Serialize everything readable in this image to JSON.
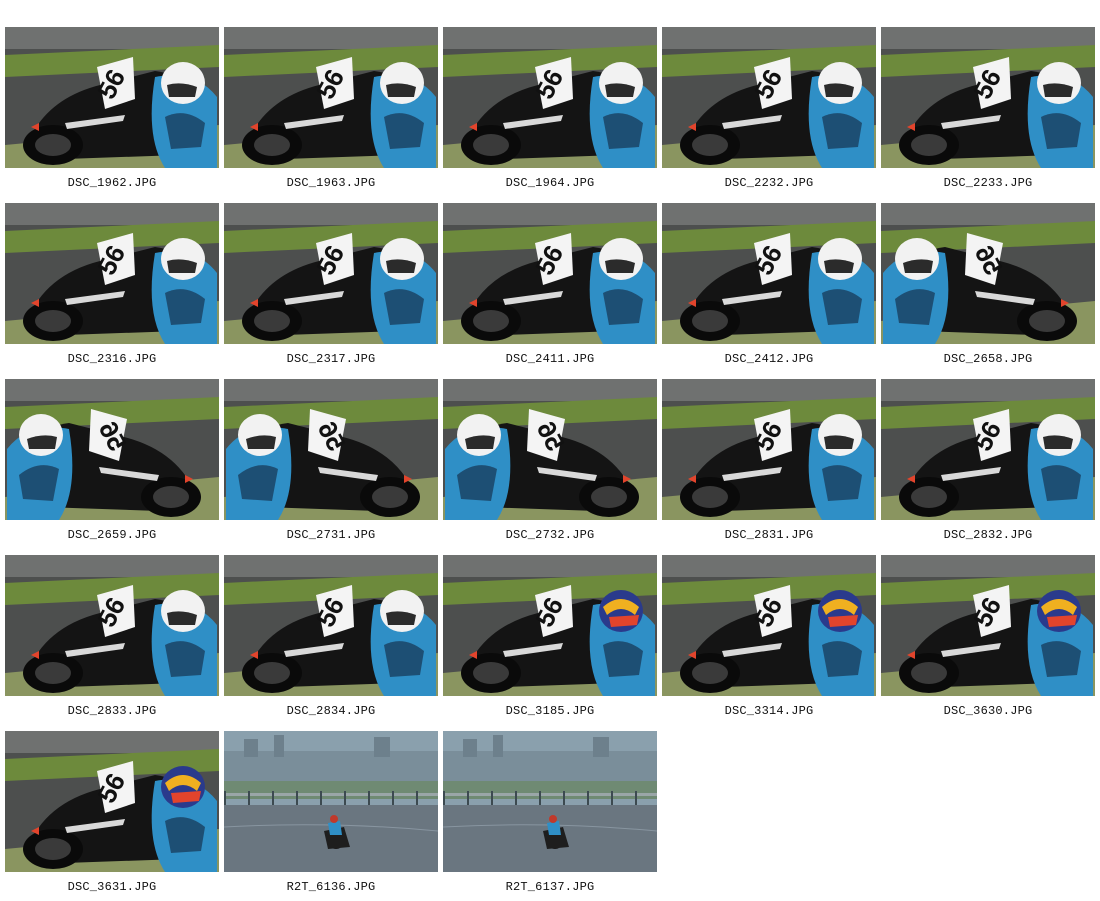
{
  "gallery": {
    "photos": [
      {
        "filename": "DSC_1962.JPG",
        "scene": "dry",
        "helmet": "white",
        "facing": "left"
      },
      {
        "filename": "DSC_1963.JPG",
        "scene": "dry",
        "helmet": "white",
        "facing": "left"
      },
      {
        "filename": "DSC_1964.JPG",
        "scene": "dry",
        "helmet": "white",
        "facing": "left"
      },
      {
        "filename": "DSC_2232.JPG",
        "scene": "dry",
        "helmet": "white",
        "facing": "left"
      },
      {
        "filename": "DSC_2233.JPG",
        "scene": "dry",
        "helmet": "white",
        "facing": "left"
      },
      {
        "filename": "DSC_2316.JPG",
        "scene": "dry",
        "helmet": "white",
        "facing": "left"
      },
      {
        "filename": "DSC_2317.JPG",
        "scene": "dry",
        "helmet": "white",
        "facing": "left"
      },
      {
        "filename": "DSC_2411.JPG",
        "scene": "dry",
        "helmet": "white",
        "facing": "left"
      },
      {
        "filename": "DSC_2412.JPG",
        "scene": "dry",
        "helmet": "white",
        "facing": "left"
      },
      {
        "filename": "DSC_2658.JPG",
        "scene": "dry",
        "helmet": "white",
        "facing": "right"
      },
      {
        "filename": "DSC_2659.JPG",
        "scene": "dry",
        "helmet": "white",
        "facing": "right"
      },
      {
        "filename": "DSC_2731.JPG",
        "scene": "dry",
        "helmet": "white",
        "facing": "right"
      },
      {
        "filename": "DSC_2732.JPG",
        "scene": "dry",
        "helmet": "white",
        "facing": "right"
      },
      {
        "filename": "DSC_2831.JPG",
        "scene": "dry",
        "helmet": "white",
        "facing": "left"
      },
      {
        "filename": "DSC_2832.JPG",
        "scene": "dry",
        "helmet": "white",
        "facing": "left"
      },
      {
        "filename": "DSC_2833.JPG",
        "scene": "dry",
        "helmet": "white",
        "facing": "left"
      },
      {
        "filename": "DSC_2834.JPG",
        "scene": "dry",
        "helmet": "white",
        "facing": "left"
      },
      {
        "filename": "DSC_3185.JPG",
        "scene": "dry",
        "helmet": "colored",
        "facing": "left"
      },
      {
        "filename": "DSC_3314.JPG",
        "scene": "dry",
        "helmet": "colored",
        "facing": "left"
      },
      {
        "filename": "DSC_3630.JPG",
        "scene": "dry",
        "helmet": "colored",
        "facing": "left"
      },
      {
        "filename": "DSC_3631.JPG",
        "scene": "dry",
        "helmet": "colored",
        "facing": "left"
      },
      {
        "filename": "R2T_6136.JPG",
        "scene": "rain",
        "helmet": "colored",
        "facing": "left"
      },
      {
        "filename": "R2T_6137.JPG",
        "scene": "rain",
        "helmet": "colored",
        "facing": "left"
      }
    ]
  },
  "palette": {
    "asphalt": "#4d4f4e",
    "grass": "#6d8a3c",
    "bike": "#141414",
    "suit": "#2f8fc6",
    "helmet_white": "#f2f2f2",
    "helmet_colored": "#2a3a8c",
    "rain_sky": "#8aa0ad"
  },
  "race_number": "56"
}
